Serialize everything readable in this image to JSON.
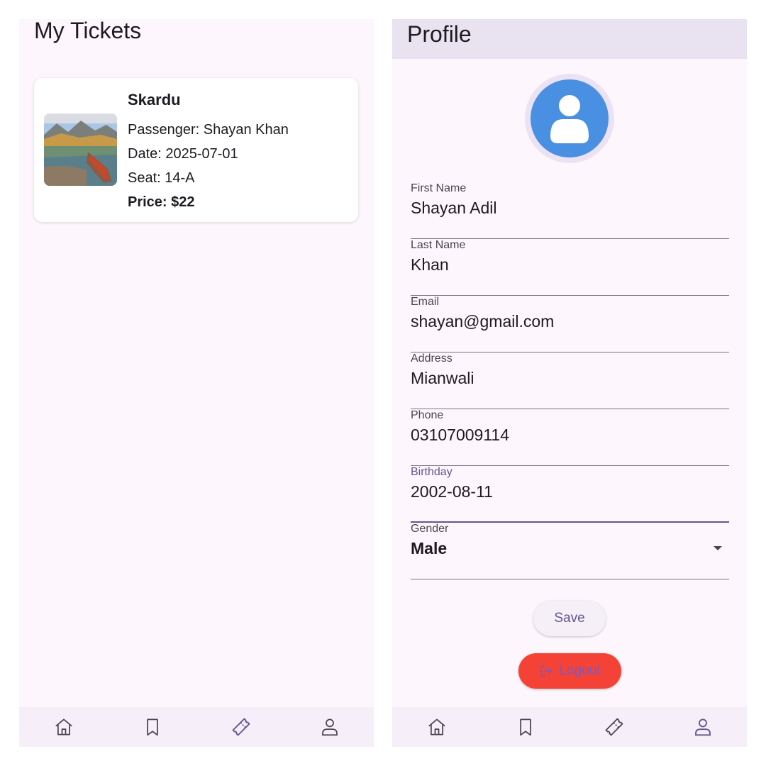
{
  "tickets_screen": {
    "title": "My Tickets",
    "tickets": [
      {
        "destination": "Skardu",
        "passenger": "Passenger: Shayan Khan",
        "date": "Date: 2025-07-01",
        "seat": "Seat: 14-A",
        "price": "Price: $22"
      }
    ]
  },
  "profile_screen": {
    "title": "Profile",
    "fields": {
      "first_name": {
        "label": "First Name",
        "value": "Shayan Adil"
      },
      "last_name": {
        "label": "Last Name",
        "value": "Khan"
      },
      "email": {
        "label": "Email",
        "value": "shayan@gmail.com"
      },
      "address": {
        "label": "Address",
        "value": "Mianwali"
      },
      "phone": {
        "label": "Phone",
        "value": "03107009114"
      },
      "birthday": {
        "label": "Birthday",
        "value": "2002-08-11"
      },
      "gender": {
        "label": "Gender",
        "value": "Male"
      }
    },
    "save_label": "Save",
    "logout_label": "Logout"
  },
  "bottom_nav": {
    "items": [
      "home-icon",
      "bookmark-icon",
      "ticket-icon",
      "person-icon"
    ]
  },
  "colors": {
    "background": "#fdf6fc",
    "nav_background": "#f6eef9",
    "appbar": "#e9e2f0",
    "primary": "#65558f",
    "avatar": "#4a90e2",
    "logout": "#f44336"
  }
}
